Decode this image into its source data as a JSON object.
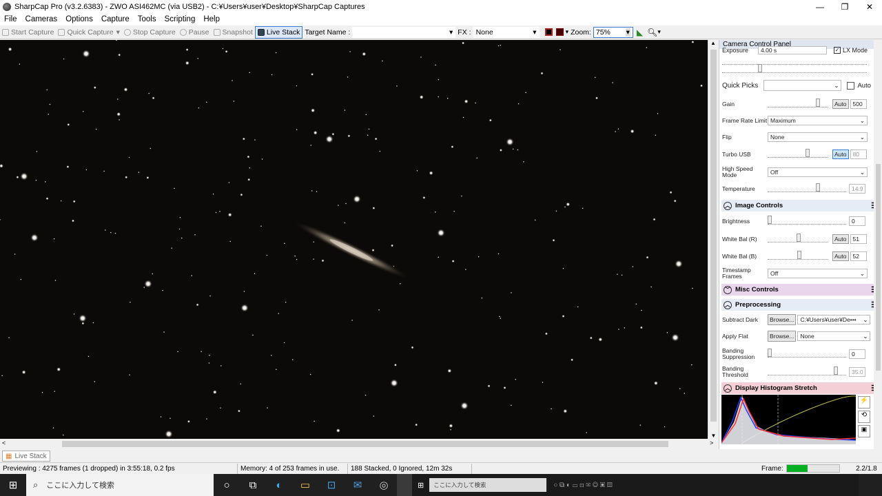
{
  "window": {
    "title": "SharpCap Pro (v3.2.6383) - ZWO ASI462MC (via USB2) - C:¥Users¥user¥Desktop¥SharpCap Captures",
    "minimize": "—",
    "maximize": "❐",
    "close": "✕"
  },
  "menu": [
    "File",
    "Cameras",
    "Options",
    "Capture",
    "Tools",
    "Scripting",
    "Help"
  ],
  "toolbar": {
    "start_capture": "Start Capture",
    "quick_capture": "Quick Capture",
    "stop_capture": "Stop Capture",
    "pause": "Pause",
    "snapshot": "Snapshot",
    "live_stack": "Live Stack",
    "target_label": "Target Name :",
    "target_value": "",
    "fx_label": "FX :",
    "fx_value": "None",
    "zoom_label": "Zoom:",
    "zoom_value": "75%"
  },
  "panel": {
    "title": "Camera Control Panel",
    "exposure_label": "Exposure",
    "exposure_value": "4.00 s",
    "lx_mode": "LX Mode",
    "quick_picks_label": "Quick Picks",
    "quick_picks_auto": "Auto",
    "gain_label": "Gain",
    "gain_value": "500",
    "auto": "Auto",
    "frame_rate_label": "Frame Rate Limit",
    "frame_rate_value": "Maximum",
    "flip_label": "Flip",
    "flip_value": "None",
    "turbo_label": "Turbo USB",
    "turbo_value": "80",
    "hsm_label": "High Speed Mode",
    "hsm_value": "Off",
    "temp_label": "Temperature",
    "temp_value": "14.9",
    "image_controls": "Image Controls",
    "brightness_label": "Brightness",
    "brightness_value": "0",
    "wbr_label": "White Bal (R)",
    "wbr_value": "51",
    "wbb_label": "White Bal (B)",
    "wbb_value": "52",
    "timestamp_label": "Timestamp Frames",
    "timestamp_value": "Off",
    "misc_controls": "Misc Controls",
    "preprocessing": "Preprocessing",
    "subtract_dark_label": "Subtract Dark",
    "browse": "Browse...",
    "subtract_dark_value": "C:¥Users¥user¥De•••",
    "apply_flat_label": "Apply Flat",
    "apply_flat_value": "None",
    "banding_supp_label": "Banding Suppression",
    "banding_supp_value": "0",
    "banding_thr_label": "Banding Threshold",
    "banding_thr_value": "35.0",
    "histogram": "Display Histogram Stretch"
  },
  "status": {
    "tab": "Live Stack",
    "preview": "Previewing : 4275 frames (1 dropped) in 3:55:18, 0.2 fps",
    "memory": "Memory: 4 of 253 frames in use.",
    "stacked": "188 Stacked, 0 Ignored, 12m 32s",
    "frame_label": "Frame:",
    "frame_ratio": "2.2/1.8",
    "frame_progress": 0.4
  },
  "taskbar": {
    "search_placeholder": "ここに入力して検索",
    "search_placeholder2": "ここに入力して検索"
  }
}
